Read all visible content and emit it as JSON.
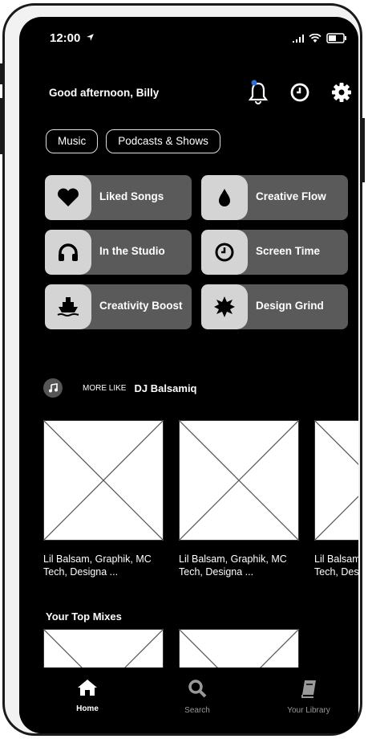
{
  "status_bar": {
    "time": "12:00"
  },
  "greeting": "Good afternoon, Billy",
  "chips": [
    "Music",
    "Podcasts & Shows"
  ],
  "shortcuts": [
    {
      "label": "Liked Songs",
      "icon": "heart-icon"
    },
    {
      "label": "Creative Flow",
      "icon": "drop-icon"
    },
    {
      "label": "In the Studio",
      "icon": "headphones-icon"
    },
    {
      "label": "Screen Time",
      "icon": "clock-icon"
    },
    {
      "label": "Creativity Boost",
      "icon": "ship-icon"
    },
    {
      "label": "Design Grind",
      "icon": "burst-icon"
    }
  ],
  "more_like": {
    "prefix": "MORE LIKE",
    "artist": "DJ Balsamiq"
  },
  "cards": [
    {
      "line1": "Lil Balsam, Graphik, MC",
      "line2": "Tech, Designa ..."
    },
    {
      "line1": "Lil Balsam, Graphik, MC",
      "line2": "Tech, Designa ..."
    },
    {
      "line1": "Lil Balsam, Graphik, MC",
      "line2": "Tech, Designa ..."
    }
  ],
  "top_mixes": "Your Top Mixes",
  "tabs": {
    "home": "Home",
    "search": "Search",
    "library": "Your Library"
  }
}
